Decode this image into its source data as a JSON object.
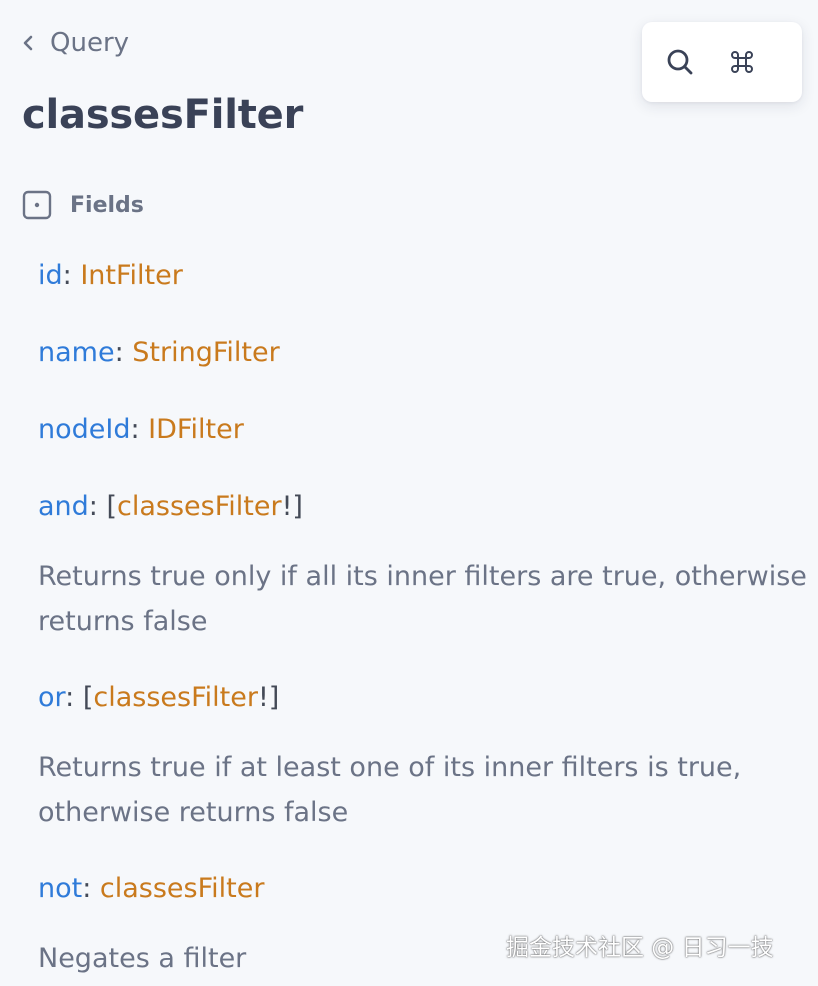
{
  "nav": {
    "back_label": "Query"
  },
  "page": {
    "title": "classesFilter"
  },
  "section": {
    "label": "Fields"
  },
  "fields": [
    {
      "name": "id",
      "type": "IntFilter"
    },
    {
      "name": "name",
      "type": "StringFilter"
    },
    {
      "name": "nodeId",
      "type": "IDFilter"
    },
    {
      "name": "and",
      "type": "classesFilter",
      "description": "Returns true only if all its inner filters are true, otherwise returns false"
    },
    {
      "name": "or",
      "type": "classesFilter",
      "description": "Returns true if at least one of its inner filters is true, otherwise returns false"
    },
    {
      "name": "not",
      "type": "classesFilter",
      "description": "Negates a filter"
    }
  ],
  "toolbar": {
    "search_icon": "search-icon",
    "shortcut_icon": "command-key-icon"
  },
  "watermark": {
    "text": "掘金技术社区 @ 日习一技"
  },
  "colors": {
    "background": "#f6f8fb",
    "field_name": "#2f7bd9",
    "field_type": "#c97a1d",
    "title": "#3a4257",
    "muted_text": "#6b7386"
  }
}
